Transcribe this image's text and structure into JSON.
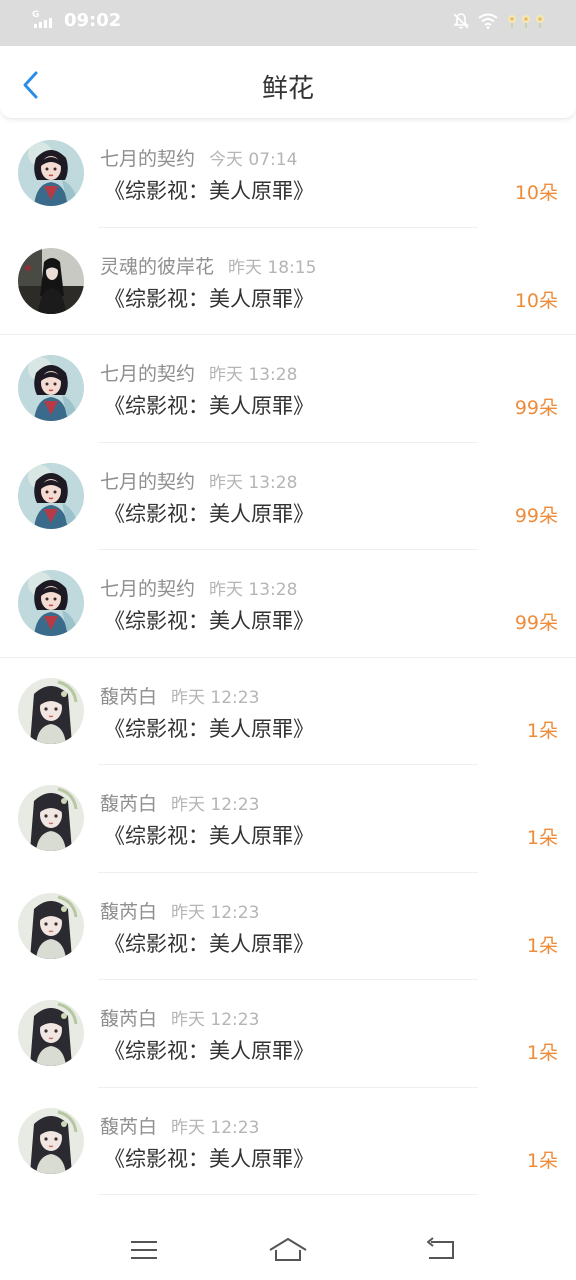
{
  "status_bar": {
    "time": "09:02",
    "signal_label": "G",
    "icons": [
      "signal-icon",
      "mute-icon",
      "wifi-icon",
      "flower-icon"
    ]
  },
  "header": {
    "title": "鲜花",
    "back_icon": "chevron-left-icon"
  },
  "accent_color": "#ee8c3a",
  "items": [
    {
      "user": "七月的契约",
      "time": "今天 07:14",
      "book": "《综影视：美人原罪》",
      "count": "10朵",
      "avatar": "avatar-a"
    },
    {
      "user": "灵魂的彼岸花",
      "time": "昨天 18:15",
      "book": "《综影视：美人原罪》",
      "count": "10朵",
      "avatar": "avatar-b"
    },
    {
      "user": "七月的契约",
      "time": "昨天 13:28",
      "book": "《综影视：美人原罪》",
      "count": "99朵",
      "avatar": "avatar-a"
    },
    {
      "user": "七月的契约",
      "time": "昨天 13:28",
      "book": "《综影视：美人原罪》",
      "count": "99朵",
      "avatar": "avatar-a"
    },
    {
      "user": "七月的契约",
      "time": "昨天 13:28",
      "book": "《综影视：美人原罪》",
      "count": "99朵",
      "avatar": "avatar-a"
    },
    {
      "user": "馥芮白",
      "time": "昨天 12:23",
      "book": "《综影视：美人原罪》",
      "count": "1朵",
      "avatar": "avatar-c"
    },
    {
      "user": "馥芮白",
      "time": "昨天 12:23",
      "book": "《综影视：美人原罪》",
      "count": "1朵",
      "avatar": "avatar-c"
    },
    {
      "user": "馥芮白",
      "time": "昨天 12:23",
      "book": "《综影视：美人原罪》",
      "count": "1朵",
      "avatar": "avatar-c"
    },
    {
      "user": "馥芮白",
      "time": "昨天 12:23",
      "book": "《综影视：美人原罪》",
      "count": "1朵",
      "avatar": "avatar-c"
    },
    {
      "user": "馥芮白",
      "time": "昨天 12:23",
      "book": "《综影视：美人原罪》",
      "count": "1朵",
      "avatar": "avatar-c"
    }
  ],
  "bottom_nav": {
    "icons": [
      "menu-icon",
      "home-icon",
      "back-icon"
    ]
  }
}
